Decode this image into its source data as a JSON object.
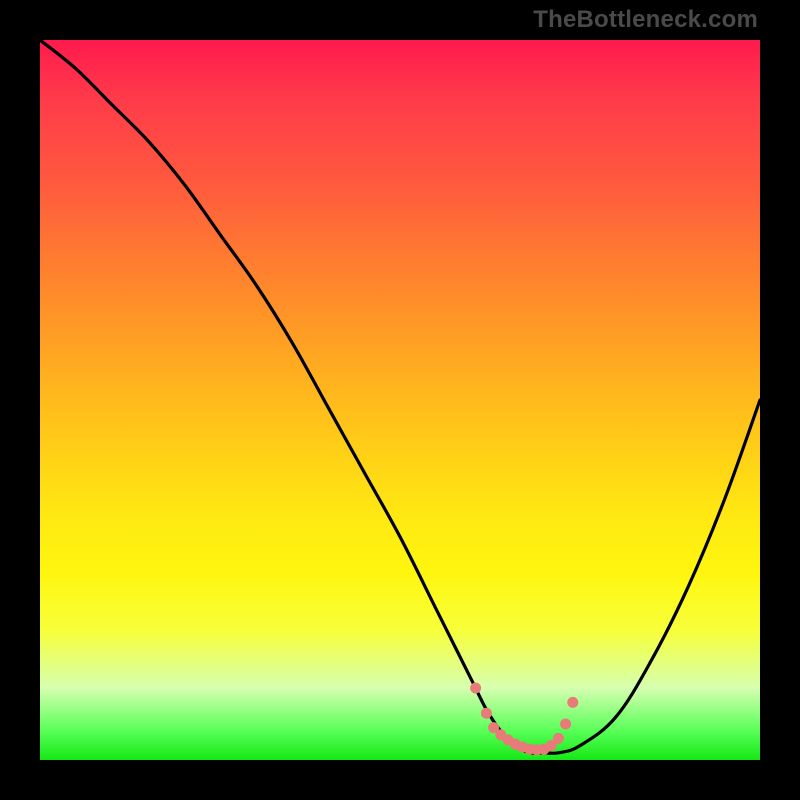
{
  "watermark": "TheBottleneck.com",
  "colors": {
    "frame": "#000000",
    "curve": "#000000",
    "accent_dots": "#e87a7a",
    "gradient_top": "#ff1a4d",
    "gradient_bottom": "#15e815"
  },
  "chart_data": {
    "type": "line",
    "title": "",
    "xlabel": "",
    "ylabel": "",
    "xlim": [
      0,
      100
    ],
    "ylim": [
      0,
      100
    ],
    "grid": false,
    "series": [
      {
        "name": "bottleneck-curve",
        "x": [
          0,
          5,
          10,
          15,
          20,
          25,
          30,
          35,
          40,
          45,
          50,
          55,
          58,
          60,
          62,
          64,
          66,
          68,
          70,
          72,
          75,
          80,
          85,
          90,
          95,
          100
        ],
        "values": [
          100,
          96,
          91,
          86,
          80,
          73,
          66,
          58,
          49,
          40,
          31,
          21,
          15,
          11,
          7,
          4,
          2,
          1,
          1,
          1,
          2,
          6,
          14,
          24,
          36,
          50
        ]
      }
    ],
    "accent_region": {
      "x_start": 60,
      "x_end": 72
    },
    "accent_dots": [
      {
        "x": 60.5,
        "y": 10
      },
      {
        "x": 62,
        "y": 6.5
      },
      {
        "x": 63,
        "y": 4.5
      },
      {
        "x": 64,
        "y": 3.5
      },
      {
        "x": 65,
        "y": 2.8
      },
      {
        "x": 66,
        "y": 2.2
      },
      {
        "x": 67,
        "y": 1.8
      },
      {
        "x": 68,
        "y": 1.5
      },
      {
        "x": 69,
        "y": 1.4
      },
      {
        "x": 70,
        "y": 1.5
      },
      {
        "x": 71,
        "y": 2.0
      },
      {
        "x": 72,
        "y": 3.0
      },
      {
        "x": 73,
        "y": 5.0
      },
      {
        "x": 74,
        "y": 8.0
      }
    ]
  }
}
